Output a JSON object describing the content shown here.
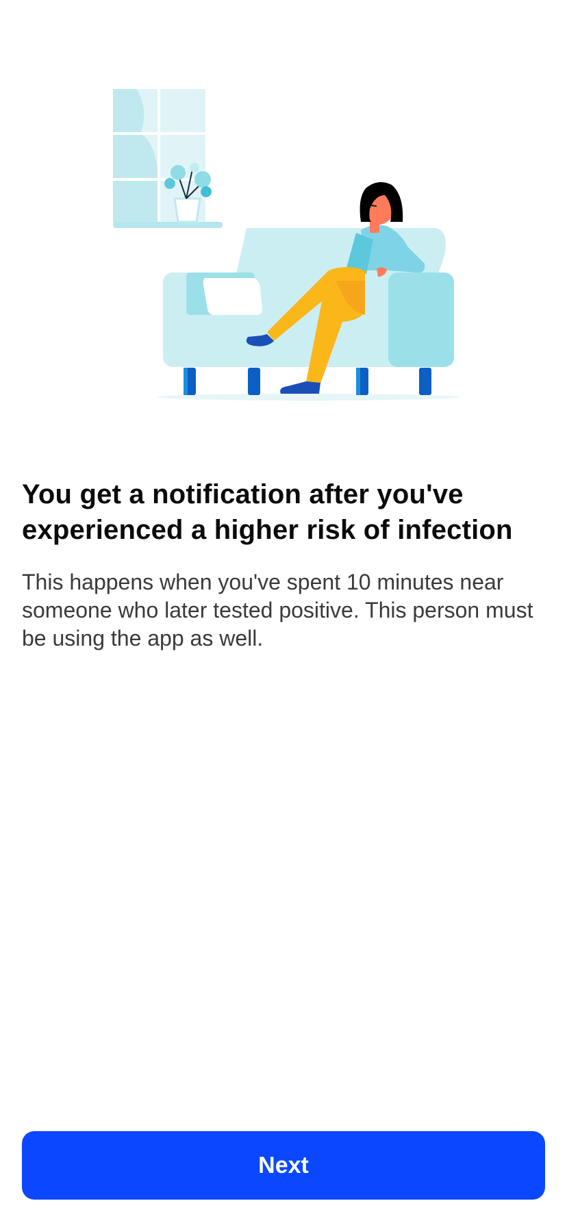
{
  "onboarding": {
    "title": "You get a notification after you've experienced a higher risk of infection",
    "description": "This happens when you've spent 10 minutes near someone who later tested positive. This person must be using the app as well.",
    "next_label": "Next"
  },
  "colors": {
    "primary_button": "#0a47ff",
    "title_text": "#0b0b0b",
    "body_text": "#3a3a3c",
    "sofa": "#cbeef2",
    "sofa_shade": "#9be0e8",
    "sofa_legs": "#0d5fc4",
    "shirt": "#7fd3e6",
    "trousers": "#fbb61a",
    "skin": "#ff7b5b",
    "hair": "#000000"
  }
}
